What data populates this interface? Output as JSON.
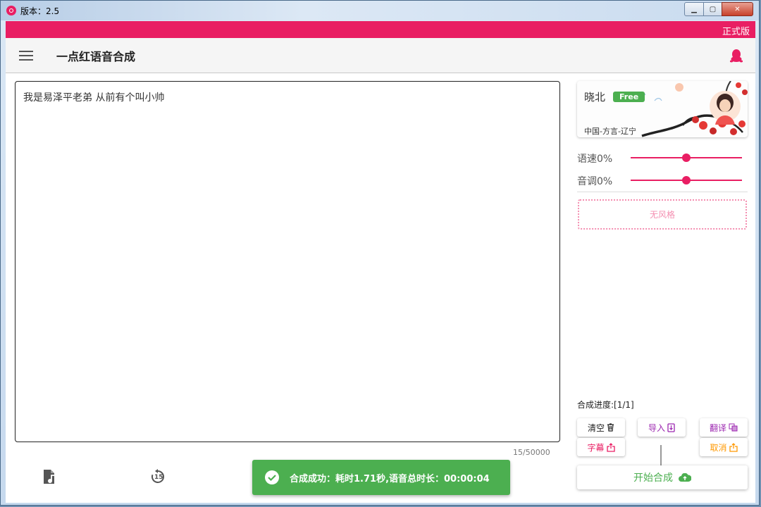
{
  "window": {
    "title": "版本：2.5",
    "min_symbol": "▁",
    "max_symbol": "▢",
    "close_symbol": "✕"
  },
  "edition": "正式版",
  "app_title": "一点红语音合成",
  "editor": {
    "text": "我是易泽平老弟 从前有个叫小帅",
    "counter": "15/50000"
  },
  "voice": {
    "name": "晓北",
    "badge": "Free",
    "region": "中国-方言-辽宁"
  },
  "sliders": [
    {
      "label": "语速0%",
      "value": 0
    },
    {
      "label": "音调0%",
      "value": 0
    }
  ],
  "style_label": "无风格",
  "progress": "合成进度:[1/1]",
  "buttons": {
    "clear": "清空",
    "import": "导入",
    "translate": "翻译",
    "subtitle": "字幕",
    "cancel": "取消",
    "start": "开始合成"
  },
  "toast": "合成成功：耗时1.71秒,语音总时长：00:00:04",
  "bottom_toolbar": {
    "replay_badge": "15"
  },
  "colors": {
    "accent": "#e91e63",
    "success": "#4caf50",
    "purple": "#9c27b0",
    "orange": "#ff9800"
  }
}
